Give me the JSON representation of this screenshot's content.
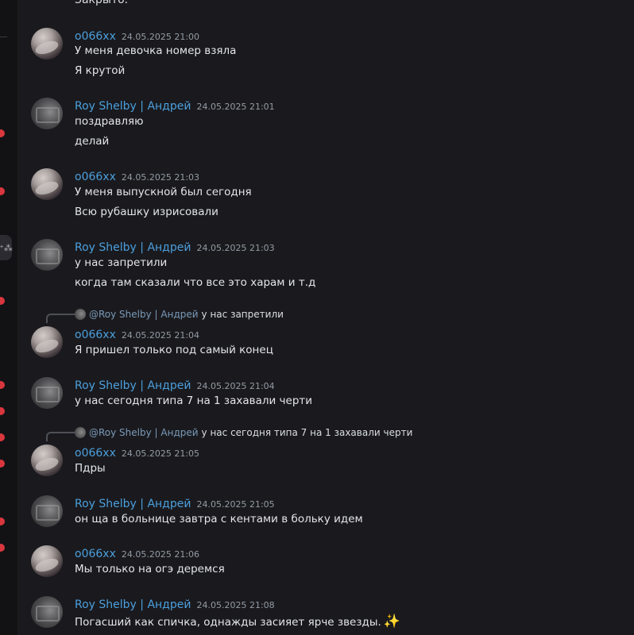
{
  "sidebar": {
    "icon": "add-friend-icon"
  },
  "top_fragment": "Закрыто.",
  "messages": [
    {
      "author": "o066xx",
      "time": "24.05.2025 21:00",
      "avatar": "o066",
      "lines": [
        "У меня девочка номер взяла",
        "Я крутой"
      ]
    },
    {
      "author": "Roy Shelby | Андрей",
      "time": "24.05.2025 21:01",
      "avatar": "roy",
      "lines": [
        "поздравляю",
        "делай"
      ]
    },
    {
      "author": "o066xx",
      "time": "24.05.2025 21:03",
      "avatar": "o066",
      "lines": [
        "У меня выпускной был сегодня",
        "Всю рубашку изрисовали"
      ]
    },
    {
      "author": "Roy Shelby | Андрей",
      "time": "24.05.2025 21:03",
      "avatar": "roy",
      "lines": [
        "у нас запретили",
        "когда там сказали что все это харам и т.д"
      ]
    },
    {
      "author": "o066xx",
      "time": "24.05.2025 21:04",
      "avatar": "o066",
      "reply": {
        "name": "@Roy Shelby | Андрей",
        "text": "у нас запретили"
      },
      "lines": [
        "Я пришел только под самый конец"
      ]
    },
    {
      "author": "Roy Shelby | Андрей",
      "time": "24.05.2025 21:04",
      "avatar": "roy",
      "lines": [
        "у нас сегодня типа 7 на 1 захавали черти"
      ]
    },
    {
      "author": "o066xx",
      "time": "24.05.2025 21:05",
      "avatar": "o066",
      "reply": {
        "name": "@Roy Shelby | Андрей",
        "text": "у нас сегодня типа 7 на 1 захавали черти"
      },
      "lines": [
        "Пдры"
      ]
    },
    {
      "author": "Roy Shelby | Андрей",
      "time": "24.05.2025 21:05",
      "avatar": "roy",
      "lines": [
        "он ща в больнице завтра с кентами в больку идем"
      ]
    },
    {
      "author": "o066xx",
      "time": "24.05.2025 21:06",
      "avatar": "o066",
      "lines": [
        "Мы только на огэ деремся"
      ]
    },
    {
      "author": "Roy Shelby | Андрей",
      "time": "24.05.2025 21:08",
      "avatar": "roy",
      "lines": [
        "Погасший как спичка, однажды засияет ярче звезды."
      ],
      "emoji": "✨"
    }
  ]
}
